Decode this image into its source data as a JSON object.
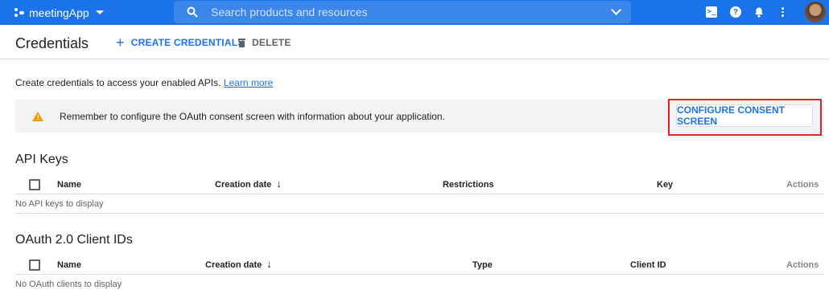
{
  "topbar": {
    "project_name": "meetingApp",
    "search_placeholder": "Search products and resources",
    "shell_glyph": ">_",
    "help_glyph": "?"
  },
  "header": {
    "title": "Credentials",
    "create_label": "CREATE CREDENTIALS",
    "create_icon": "+",
    "delete_label": "DELETE"
  },
  "intro": {
    "text": "Create credentials to access your enabled APIs.",
    "link": "Learn more"
  },
  "banner": {
    "icon": "warning-icon",
    "text": "Remember to configure the OAuth consent screen with information about your application.",
    "button_label": "CONFIGURE CONSENT SCREEN"
  },
  "api_keys": {
    "title": "API Keys",
    "columns": {
      "name": "Name",
      "created": "Creation date",
      "restrictions": "Restrictions",
      "key": "Key",
      "actions": "Actions"
    },
    "empty": "No API keys to display"
  },
  "oauth": {
    "title": "OAuth 2.0 Client IDs",
    "columns": {
      "name": "Name",
      "created": "Creation date",
      "type": "Type",
      "client_id": "Client ID",
      "actions": "Actions"
    },
    "empty": "No OAuth clients to display"
  },
  "sort_arrow": "↓",
  "colors": {
    "brand": "#1a73e8",
    "warning": "#f29900",
    "highlight": "#e52020"
  }
}
